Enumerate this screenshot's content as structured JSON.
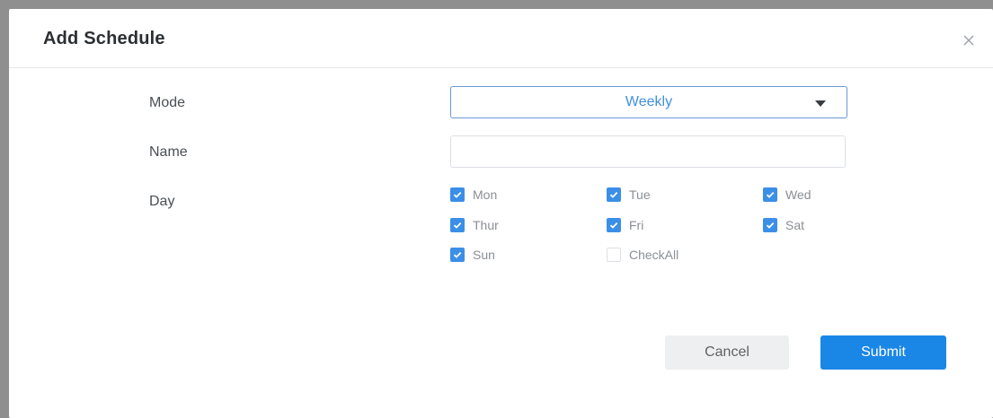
{
  "dialog": {
    "title": "Add Schedule",
    "close_icon": "close-icon"
  },
  "form": {
    "mode": {
      "label": "Mode",
      "value": "Weekly"
    },
    "name": {
      "label": "Name",
      "value": "",
      "placeholder": ""
    },
    "day": {
      "label": "Day",
      "options": [
        {
          "label": "Mon",
          "checked": true
        },
        {
          "label": "Tue",
          "checked": true
        },
        {
          "label": "Wed",
          "checked": true
        },
        {
          "label": "Thur",
          "checked": true
        },
        {
          "label": "Fri",
          "checked": true
        },
        {
          "label": "Sat",
          "checked": true
        },
        {
          "label": "Sun",
          "checked": true
        },
        {
          "label": "CheckAll",
          "checked": false
        }
      ]
    }
  },
  "actions": {
    "cancel_label": "Cancel",
    "submit_label": "Submit"
  },
  "colors": {
    "accent": "#1a86e6",
    "checkbox_checked": "#3b8fe6",
    "select_text": "#3f8fe0"
  }
}
